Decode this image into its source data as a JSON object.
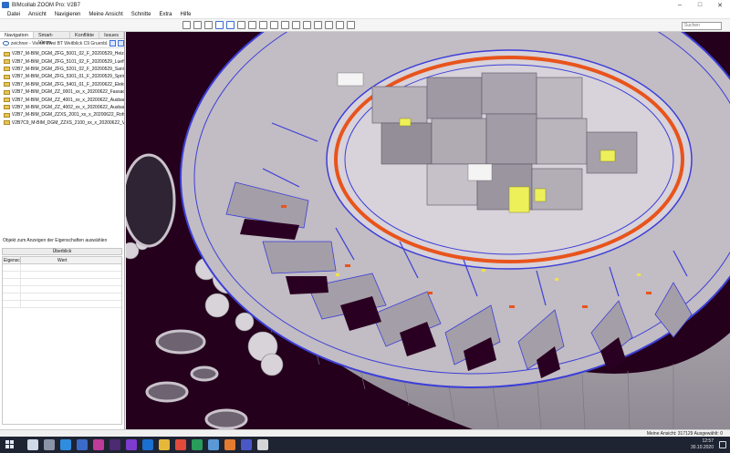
{
  "window": {
    "title": "BIMcollab ZOOM Pro: V2B7",
    "controls": [
      "–",
      "□",
      "✕"
    ]
  },
  "menu": {
    "items": [
      "Datei",
      "Ansicht",
      "Navigieren",
      "Meine Ansicht",
      "Schnitte",
      "Extra",
      "Hilfe"
    ]
  },
  "search": {
    "placeholder": "Suchen"
  },
  "panel": {
    "tabs": [
      "Navigation",
      "Smart-Views",
      "Konflikte",
      "Issues"
    ],
    "path": "zeichner - Viertel Zwei BT Weitblick C9 Gruenbl...",
    "files": [
      "V2B7_M-BIM_DGM_ZFG_5001_02_F_20200529_Heizung...",
      "V2B7_M-BIM_DGM_ZFG_5101_02_F_20200529_Lueftung",
      "V2B7_M-BIM_DGM_ZFG_5201_02_F_20200529_Sanitaer",
      "V2B7_M-BIM_DGM_ZFG_5301_01_F_20200529_Sprinkler",
      "V2B7_M-BIM_DGM_ZFG_5401_01_F_20200622_Elektro",
      "V2B7_M-BIM_DGM_ZZ_0001_xx_x_20200622_Fassade",
      "V2B7_M-BIM_DGM_ZZ_4001_xx_x_20200622_Ausbau-1",
      "V2B7_M-BIM_DGM_ZZ_4002_xx_x_20200622_Ausbau-2",
      "V2B7_M-BIM_DGM_ZZXS_2001_xx_x_20200622_Rohbau",
      "V2B7C9_M-BIM_DGM_ZZXS_2100_xx_x_20200622_Vord..."
    ],
    "properties_hint": "Objekt zum Anzeigen der Eigenschaften auswählen",
    "overview_label": "Überblick",
    "grid_col1": "Eigensc...",
    "grid_col2": "Wert"
  },
  "status": {
    "text": "Meine Ansicht: 317129 Ausgewählt: 0"
  },
  "taskbar": {
    "time": "12:57",
    "date": "30.10.2020"
  },
  "colors": {
    "accent": "#3a6ed8",
    "viewport_bg": "#24001c",
    "duct_orange": "#e8541c",
    "mep_blue": "#3c3fd8",
    "concrete": "#b9b3bb"
  }
}
